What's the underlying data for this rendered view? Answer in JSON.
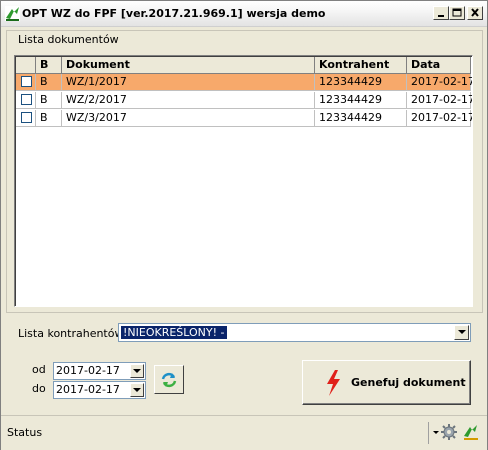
{
  "window": {
    "title": "OPT WZ do FPF [ver.2017.21.969.1]  wersja demo",
    "controls": [
      "minimize-icon",
      "maximize-icon",
      "close-icon"
    ]
  },
  "document_list": {
    "group_label": "Lista dokumentów",
    "columns": [
      "",
      "B",
      "Dokument",
      "Kontrahent",
      "Data"
    ],
    "rows": [
      {
        "checked": false,
        "b": "B",
        "dokument": "WZ/1/2017",
        "kontrahent": "123344429",
        "data": "2017-02-17",
        "selected": true
      },
      {
        "checked": false,
        "b": "B",
        "dokument": "WZ/2/2017",
        "kontrahent": "123344429",
        "data": "2017-02-17",
        "selected": false
      },
      {
        "checked": false,
        "b": "B",
        "dokument": "WZ/3/2017",
        "kontrahent": "123344429",
        "data": "2017-02-17",
        "selected": false
      }
    ],
    "selected_row_color": "#f7a96b"
  },
  "contractors": {
    "label": "Lista kontrahentów",
    "selected": "!NIEOKREŚLONY! -"
  },
  "date_range": {
    "from_label": "od",
    "from_value": "2017-02-17",
    "to_label": "do",
    "to_value": "2017-02-17"
  },
  "actions": {
    "refresh_icon": "refresh-icon",
    "generate_label": "Genefuj dokument",
    "generate_icon": "lightning-icon"
  },
  "statusbar": {
    "status_text": "Status",
    "icons": [
      "dropdown-arrow-icon",
      "gear-icon",
      "app-logo-icon"
    ]
  }
}
